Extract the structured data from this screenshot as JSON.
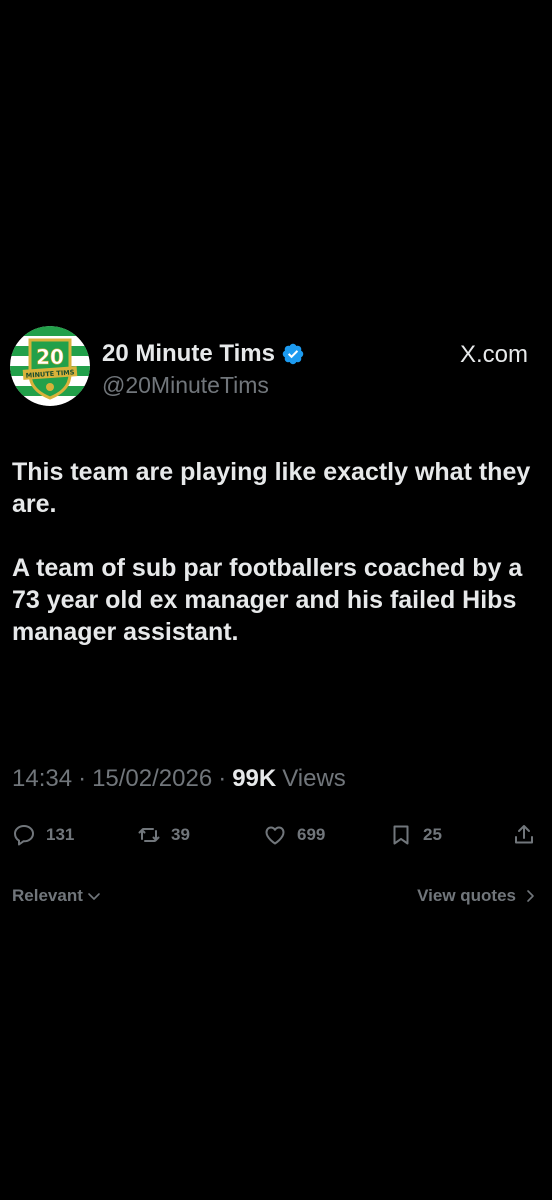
{
  "author": {
    "display_name": "20 Minute Tims",
    "handle": "@20MinuteTims",
    "verified": true,
    "avatar_text_number": "20",
    "avatar_text_banner": "MINUTE TIMS"
  },
  "site_label": "X.com",
  "tweet": {
    "paragraph_1": "This team are playing like exactly what they are.",
    "paragraph_2": "A team of sub par footballers coached by a 73 year old ex manager and his failed Hibs manager assistant."
  },
  "meta": {
    "time": "14:34",
    "date": "15/02/2026",
    "separator": "·",
    "views_count": "99K",
    "views_label": "Views"
  },
  "actions": {
    "replies": "131",
    "reposts": "39",
    "likes": "699",
    "bookmarks": "25"
  },
  "footer": {
    "sort_label": "Relevant",
    "view_quotes_label": "View quotes"
  },
  "colors": {
    "background": "#000000",
    "primary_text": "#e7e9ea",
    "secondary_text": "#71767b",
    "verified_blue": "#1d9bf0",
    "avatar_green": "#22a04a",
    "avatar_gold": "#d8b23a"
  },
  "icons": {
    "verified": "verified-badge-icon",
    "reply": "reply-icon",
    "repost": "repost-icon",
    "like": "heart-icon",
    "bookmark": "bookmark-icon",
    "share": "share-icon",
    "sort": "chevron-down-icon",
    "view_quotes": "chevron-right-icon"
  }
}
